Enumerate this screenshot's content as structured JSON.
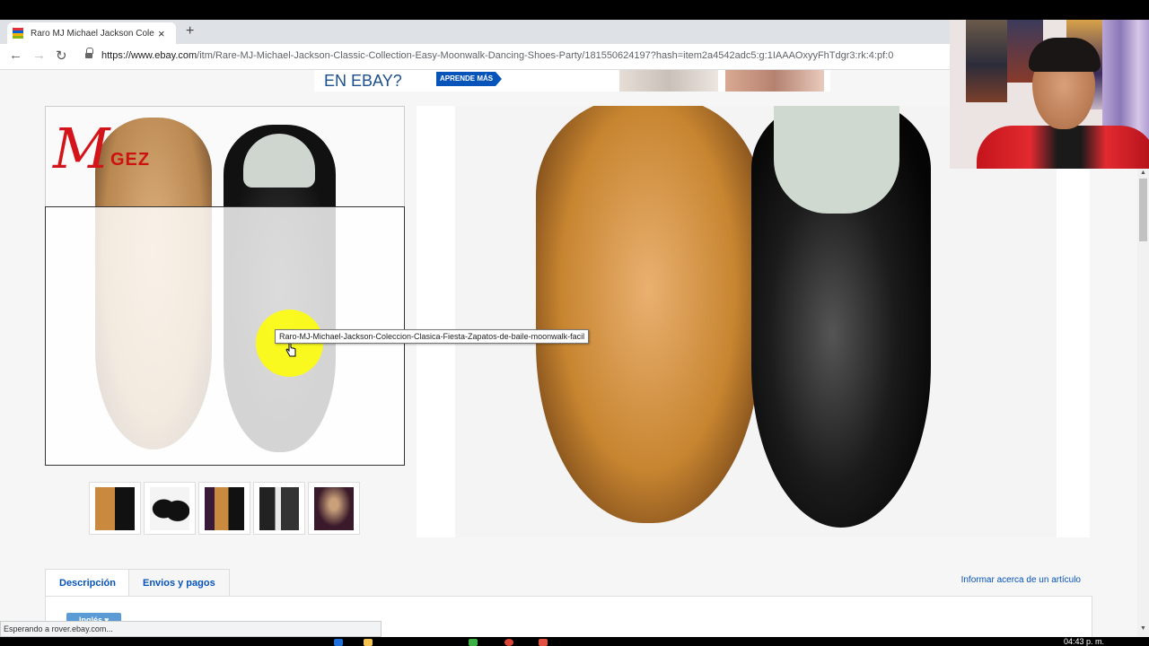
{
  "browser": {
    "tab_title": "Raro MJ Michael Jackson Coleccion",
    "tab_close": "×",
    "new_tab": "+",
    "back": "←",
    "forward": "→",
    "reload": "↻",
    "url_host": "https://www.ebay.com",
    "url_path": "/itm/Rare-MJ-Michael-Jackson-Classic-Collection-Easy-Moonwalk-Dancing-Shoes-Party/181550624197?hash=item2a4542adc5:g:1IAAAOxyyFhTdgr3:rk:4:pf:0"
  },
  "banner": {
    "text": "EN EBAY?",
    "button": "APRENDE MÁS"
  },
  "product": {
    "logo_letter": "M",
    "logo_text": "GEZ",
    "tooltip": "Raro-MJ-Michael-Jackson-Coleccion-Clasica-Fiesta-Zapatos-de-baile-moonwalk-facil"
  },
  "tabs": {
    "description": "Descripción",
    "shipping": "Envios y pagos",
    "report": "Informar acerca de un artículo"
  },
  "language_button": "Inglés ▾",
  "status_text": "Esperando a rover.ebay.com...",
  "taskbar_time": "04:43 p. m.",
  "colors": {
    "ebay_blue": "#0654ba",
    "highlight_yellow": "#ffff00"
  }
}
